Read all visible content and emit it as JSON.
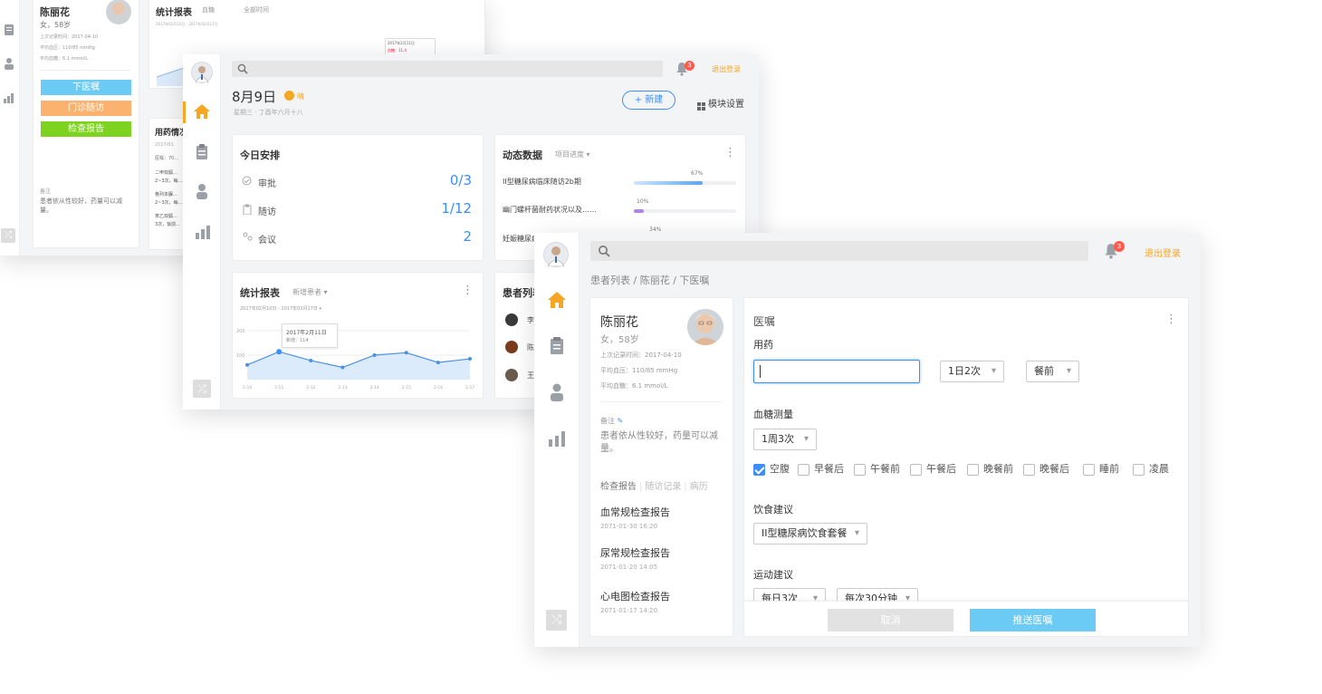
{
  "back": {
    "patient": {
      "name": "陈丽花",
      "gender_age": "女，58岁",
      "last_record": "上次记录时间：2017-04-10",
      "bp": "平均血压：110/85 mmHg",
      "glucose": "平均血糖：6.1 mmol/L"
    },
    "buttons": {
      "prescribe": "下医嘱",
      "followup": "门诊随访",
      "report": "检查报告"
    },
    "note": {
      "label": "备注",
      "text": "患者依从性较好，药量可以减量。"
    },
    "stats": {
      "title": "统计报表",
      "filter1": "血糖",
      "filter2": "全部时间",
      "range": "2017年02月10日 - 2017年02月17日",
      "tooltip": "2017年2月11日",
      "tooltip_value": "血糖：11.4"
    },
    "med": {
      "title": "用药情况",
      "date": "2017/01",
      "row0": "医嘱：70…",
      "row1": "二甲双胍…",
      "row2": "2~3次，每…",
      "row3": "格列本脲…",
      "row4": "2~3次，每…",
      "row5": "苯乙双胍…",
      "row6": "3次，饭前…"
    }
  },
  "middle": {
    "date": "8月9日",
    "weather": "晴",
    "lunar": "星期三 · 丁酉年六月十八",
    "new_btn": "+ 新建",
    "module_btn": "模块设置",
    "bell_count": "3",
    "logout": "退出登录",
    "schedule": {
      "title": "今日安排",
      "items": [
        {
          "label": "审批",
          "value": "0/3"
        },
        {
          "label": "随访",
          "value": "1/12"
        },
        {
          "label": "会议",
          "value": "2"
        }
      ]
    },
    "dynamic": {
      "title": "动态数据",
      "filter": "项目进度",
      "items": [
        {
          "label": "II型糖尿病临床随访2b期",
          "pct": "67%",
          "val": 0.67
        },
        {
          "label": "幽门螺杆菌耐药状况以及……",
          "pct": "10%",
          "val": 0.1
        },
        {
          "label": "妊娠糖尿病…",
          "pct": "34%",
          "val": 0.34
        }
      ]
    },
    "stats": {
      "title": "统计报表",
      "filter": "新增患者",
      "range": "2017年02月10日 - 2017年02月17日",
      "tooltip": "2017年2月11日",
      "tooltip_value": "新增：114"
    },
    "patients": {
      "title": "患者列表",
      "items": [
        "李",
        "陈",
        "王"
      ]
    }
  },
  "chart_data": {
    "type": "area",
    "x": [
      "2-10",
      "2-11",
      "2-12",
      "2-13",
      "2-14",
      "2-15",
      "2-16",
      "2-17"
    ],
    "values": [
      60,
      114,
      78,
      50,
      100,
      110,
      70,
      85
    ],
    "ylim": [
      0,
      200
    ],
    "yticks": [
      "200",
      "100"
    ]
  },
  "front": {
    "bell_count": "3",
    "logout": "退出登录",
    "breadcrumb": "患者列表 / 陈丽花 / 下医嘱",
    "patient": {
      "name": "陈丽花",
      "gender_age": "女，58岁",
      "last_record": "上次记录时间：2017-04-10",
      "bp": "平均血压：110/85 mmHg",
      "glucose": "平均血糖：6.1 mmol/L"
    },
    "note": {
      "label": "备注",
      "text": "患者依从性较好，药量可以减量。"
    },
    "tabs": [
      "检查报告",
      "随访记录",
      "病历"
    ],
    "reports": [
      {
        "title": "血常规检查报告",
        "date": "2071-01-30 16:20"
      },
      {
        "title": "尿常规检查报告",
        "date": "2071-01-20 14:05"
      },
      {
        "title": "心电图检查报告",
        "date": "2071-01-17 14:20"
      }
    ],
    "order": {
      "title": "医嘱",
      "med_label": "用药",
      "freq": "1日2次",
      "timing": "餐前",
      "glucose_label": "血糖测量",
      "glucose_freq": "1周3次",
      "checks": [
        {
          "label": "空腹",
          "on": true
        },
        {
          "label": "早餐后",
          "on": false
        },
        {
          "label": "午餐前",
          "on": false
        },
        {
          "label": "午餐后",
          "on": false
        },
        {
          "label": "晚餐前",
          "on": false
        },
        {
          "label": "晚餐后",
          "on": false
        },
        {
          "label": "睡前",
          "on": false
        },
        {
          "label": "凌晨",
          "on": false
        }
      ],
      "diet_label": "饮食建议",
      "diet": "II型糖尿病饮食套餐",
      "sport_label": "运动建议",
      "sport_freq": "每日3次",
      "sport_dur": "每次30分钟",
      "cancel": "取消",
      "send": "推送医嘱"
    }
  },
  "colors": {
    "accent": "#3d8ef7",
    "orange": "#f5a623",
    "green": "#7ed321",
    "sky": "#6ccbf5"
  }
}
